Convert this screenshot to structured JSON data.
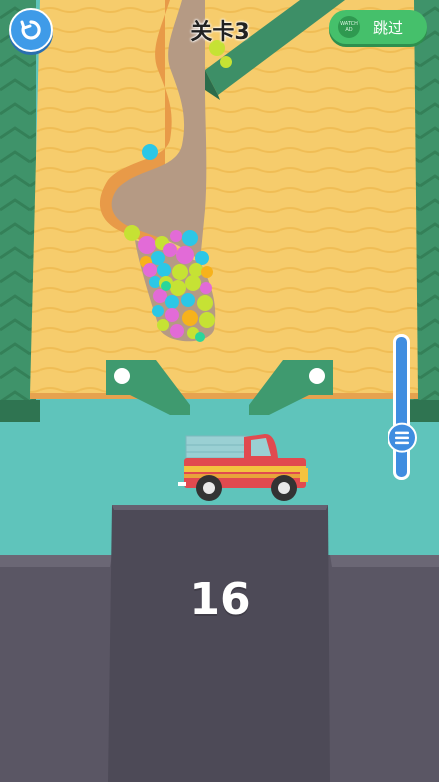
{
  "header": {
    "level_label": "关卡3",
    "skip_label": "跳过",
    "skip_ad_icon_text": "WATCH AD",
    "restart_icon": "restart-icon"
  },
  "game": {
    "balls_count_label": "16",
    "flow_slider_value": 0.24
  },
  "colors": {
    "sand": "#f5ca6b",
    "sand_edge": "#e49a45",
    "dug_path": "#b49882",
    "wall_green": "#3d8f67",
    "water": "#5fc4bb",
    "pedestal": "#56525f",
    "truck_red": "#e14a4f",
    "truck_yellow": "#f3c33f",
    "slider_blue": "#3f8de0"
  }
}
